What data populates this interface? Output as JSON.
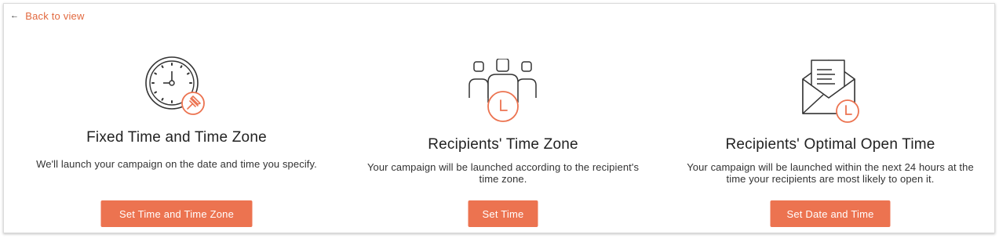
{
  "nav": {
    "back_label": "Back to view",
    "back_icon": "arrow-left-icon"
  },
  "options": [
    {
      "title": "Fixed Time and Time Zone",
      "description": "We'll launch your campaign on the date and time you specify.",
      "button_label": "Set Time and Time Zone",
      "icon": "clock-pin-icon"
    },
    {
      "title": "Recipients' Time Zone",
      "description": "Your campaign will be launched according to the recipient's time zone.",
      "button_label": "Set Time",
      "icon": "recipients-clock-icon"
    },
    {
      "title": "Recipients' Optimal Open Time",
      "description": "Your campaign will be launched within the next 24 hours at the time your recipients are most likely to open it.",
      "button_label": "Set Date and Time",
      "icon": "envelope-clock-icon"
    }
  ],
  "colors": {
    "accent": "#ec7350",
    "link": "#e2693f",
    "icon_stroke": "#333333",
    "border": "#dcdcdc"
  }
}
